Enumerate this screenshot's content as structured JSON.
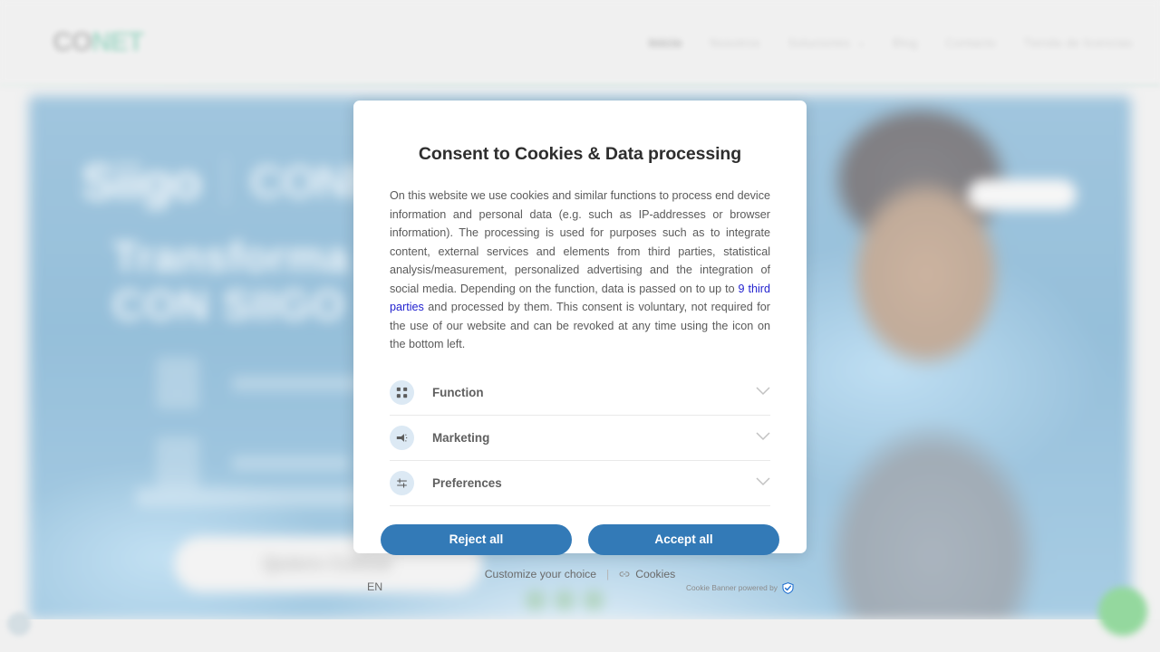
{
  "site": {
    "logo": {
      "mark": "CO",
      "word": "NET"
    },
    "nav": [
      {
        "label": "Inicio",
        "active": true,
        "caret": false
      },
      {
        "label": "Nosotros",
        "active": false,
        "caret": false
      },
      {
        "label": "Soluciones",
        "active": false,
        "caret": true
      },
      {
        "label": "Blog",
        "active": false,
        "caret": false
      },
      {
        "label": "Contacto",
        "active": false,
        "caret": false
      },
      {
        "label": "Tienda de licencias",
        "active": false,
        "caret": false
      }
    ]
  },
  "hero": {
    "logo_left": "Siigo",
    "logo_right": "CONET",
    "headline_line1": "Transforma",
    "headline_line2": "CON SIIGO",
    "cta_label": "Quiero Cotizar"
  },
  "modal": {
    "title": "Consent to Cookies & Data processing",
    "body_before_link": "On this website we use cookies and similar functions to process end device information and personal data (e.g. such as IP-addresses or browser information). The processing is used for purposes such as to integrate content, external services and elements from third parties, statistical analysis/measurement, personalized advertising and the integration of social media. Depending on the function, data is passed on to up to ",
    "body_link": "9 third parties",
    "body_after_link": " and processed by them. This consent is voluntary, not required for the use of our website and can be revoked at any time using the icon on the bottom left.",
    "categories": [
      {
        "label": "Function",
        "icon": "grid-icon",
        "expanded": false
      },
      {
        "label": "Marketing",
        "icon": "megaphone-icon",
        "expanded": false
      },
      {
        "label": "Preferences",
        "icon": "sliders-icon",
        "expanded": false
      }
    ],
    "reject_label": "Reject all",
    "accept_label": "Accept all",
    "customize_label": "Customize your choice",
    "separator": "|",
    "cookies_label": "Cookies",
    "language": "EN",
    "powered_by": "Cookie Banner powered by",
    "accent_color": "#337ab7",
    "link_color": "#2323cf"
  }
}
